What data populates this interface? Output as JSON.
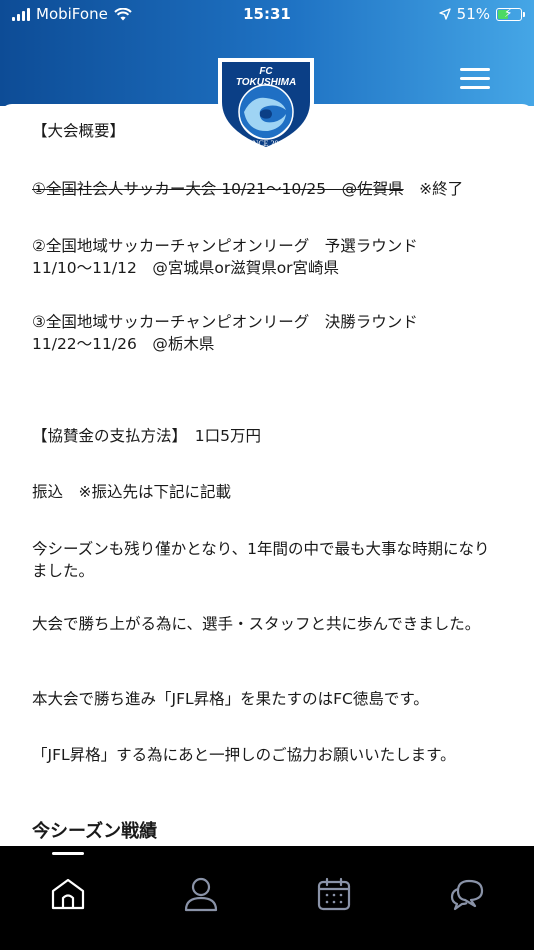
{
  "status": {
    "carrier": "MobiFone",
    "time": "15:31",
    "battery": "51%",
    "battery_level": 0.51
  },
  "header": {
    "logo": {
      "top_text": "FC",
      "name": "TOKUSHIMA",
      "since": "SINCE 2016"
    }
  },
  "content": {
    "overview_heading": "【大会概要】",
    "item1": "①全国社会人サッカー大会 10/21～10/25　@佐賀県",
    "item1_suffix": "　※終了",
    "item2": "②全国地域サッカーチャンピオンリーグ　予選ラウンド\n11/10～11/12　@宮城県or滋賀県or宮崎県",
    "item3": "③全国地域サッカーチャンピオンリーグ　決勝ラウンド\n11/22～11/26　@栃木県",
    "payment": "【協賛金の支払方法】　1口5万円",
    "transfer": "振込　※振込先は下記に記載",
    "para1": "今シーズンも残り僅かとなり、1年間の中で最も大事な時期になりました。",
    "para2": "大会で勝ち上がる為に、選手・スタッフと共に歩んできました。",
    "para3": "本大会で勝ち進み「JFL昇格」を果たすのはFC徳島です。",
    "para4": "「JFL昇格」する為にあと一押しのご協力お願いいたします。",
    "season_heading": "今シーズン戦績"
  },
  "colors": {
    "header_start": "#0d4c96",
    "header_end": "#45a6e6",
    "tab_bar": "#000000",
    "tab_icon_inactive": "#8a93a8"
  },
  "tabs": [
    {
      "icon": "home-icon",
      "active": true
    },
    {
      "icon": "user-icon",
      "active": false
    },
    {
      "icon": "calendar-icon",
      "active": false
    },
    {
      "icon": "chat-icon",
      "active": false
    }
  ]
}
